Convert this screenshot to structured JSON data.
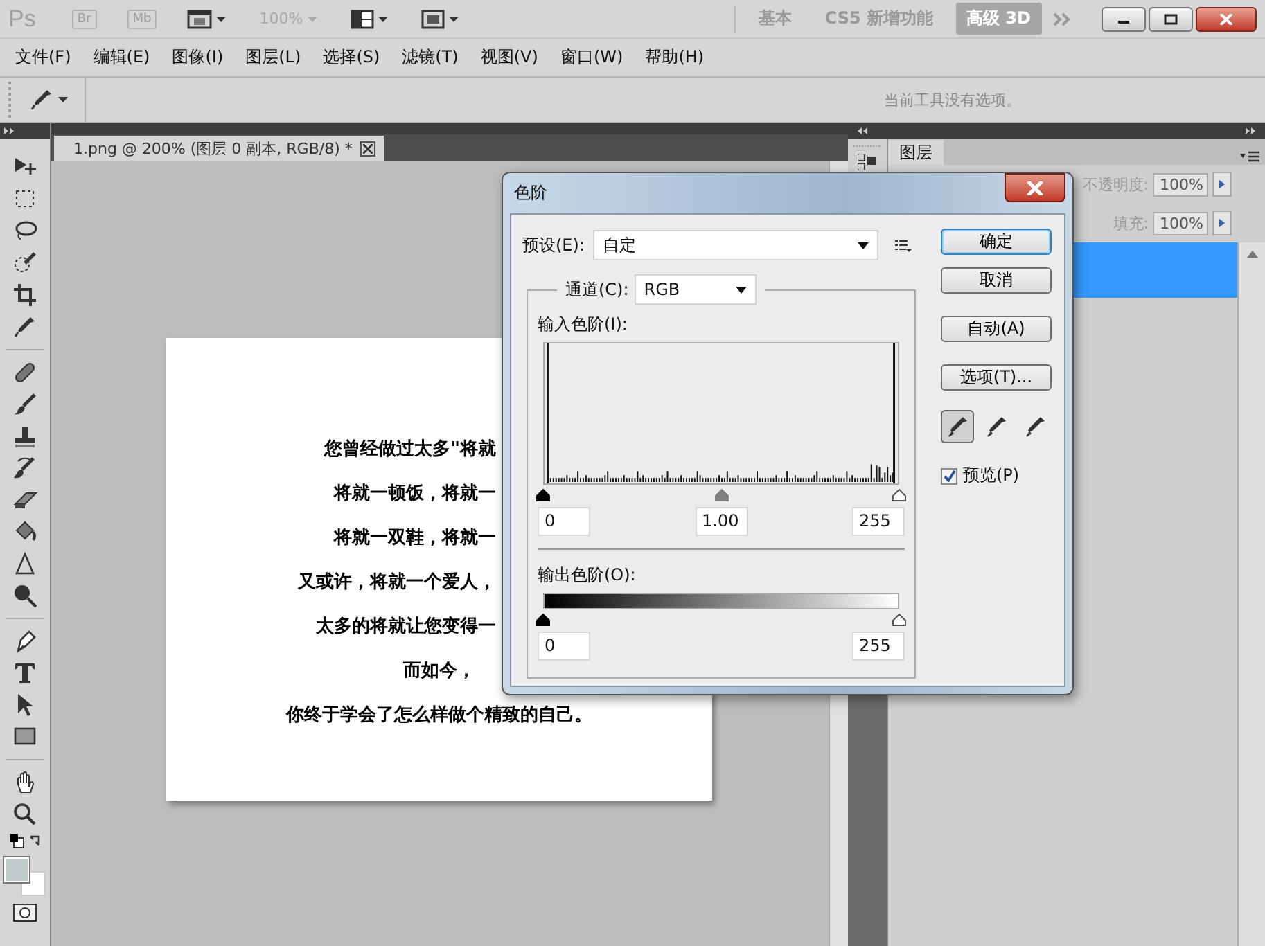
{
  "app_bar": {
    "logo": "Ps",
    "bridge": "Br",
    "mini_bridge": "Mb",
    "zoom": {
      "value": "100%",
      "disabled": true
    },
    "workspaces": [
      {
        "label": "基本",
        "selected": false
      },
      {
        "label": "CS5 新增功能",
        "selected": false
      },
      {
        "label": "高级 3D",
        "selected": true
      }
    ]
  },
  "menu": [
    "文件(F)",
    "编辑(E)",
    "图像(I)",
    "图层(L)",
    "选择(S)",
    "滤镜(T)",
    "视图(V)",
    "窗口(W)",
    "帮助(H)"
  ],
  "options_bar": {
    "message": "当前工具没有选项。"
  },
  "document": {
    "tab": {
      "title": "1.png @ 200% (图层 0 副本, RGB/8) *",
      "selected": true
    },
    "lines": [
      {
        "text": "您曾经做过太多\"将就",
        "kind": "cut"
      },
      {
        "text": "将就一顿饭，将就一",
        "kind": "cut"
      },
      {
        "text": "将就一双鞋，将就一",
        "kind": "cut"
      },
      {
        "text": "又或许，将就一个爱人，",
        "kind": "cut"
      },
      {
        "text": "太多的将就让您变得一",
        "kind": "cut"
      },
      {
        "text": "而如今，",
        "kind": "center"
      },
      {
        "text": "你终于学会了怎么样做个精致的自己。",
        "kind": "center"
      }
    ]
  },
  "layers_panel": {
    "tab": {
      "label": "图层",
      "selected": true
    },
    "opacity": {
      "label": "不透明度:",
      "value": "100%"
    },
    "fill": {
      "label": "填充:",
      "value": "100%"
    },
    "layers": [
      {
        "selected": true
      }
    ]
  },
  "dialog": {
    "title": "色阶",
    "preset": {
      "label": "预设(E):",
      "value": "自定"
    },
    "channel": {
      "label": "通道(C):",
      "value": "RGB"
    },
    "input": {
      "label": "输入色阶(I):",
      "handles": [
        {
          "color": "#000000"
        },
        {
          "color": "#808080"
        },
        {
          "color": "#ffffff"
        }
      ],
      "values": [
        "0",
        "1.00",
        "255"
      ]
    },
    "output": {
      "label": "输出色阶(O):",
      "handles": [
        {
          "color": "#000000"
        },
        {
          "color": "#ffffff"
        }
      ],
      "values": [
        "0",
        "255"
      ]
    },
    "buttons": [
      {
        "label": "确定",
        "default": true
      },
      {
        "label": "取消",
        "default": false
      },
      {
        "label": "自动(A)",
        "default": false
      },
      {
        "label": "选项(T)...",
        "default": false
      }
    ],
    "eyedroppers": [
      {
        "selected": true
      },
      {
        "selected": false
      },
      {
        "selected": false
      }
    ],
    "preview": {
      "label": "预览(P)",
      "checked": true
    }
  }
}
